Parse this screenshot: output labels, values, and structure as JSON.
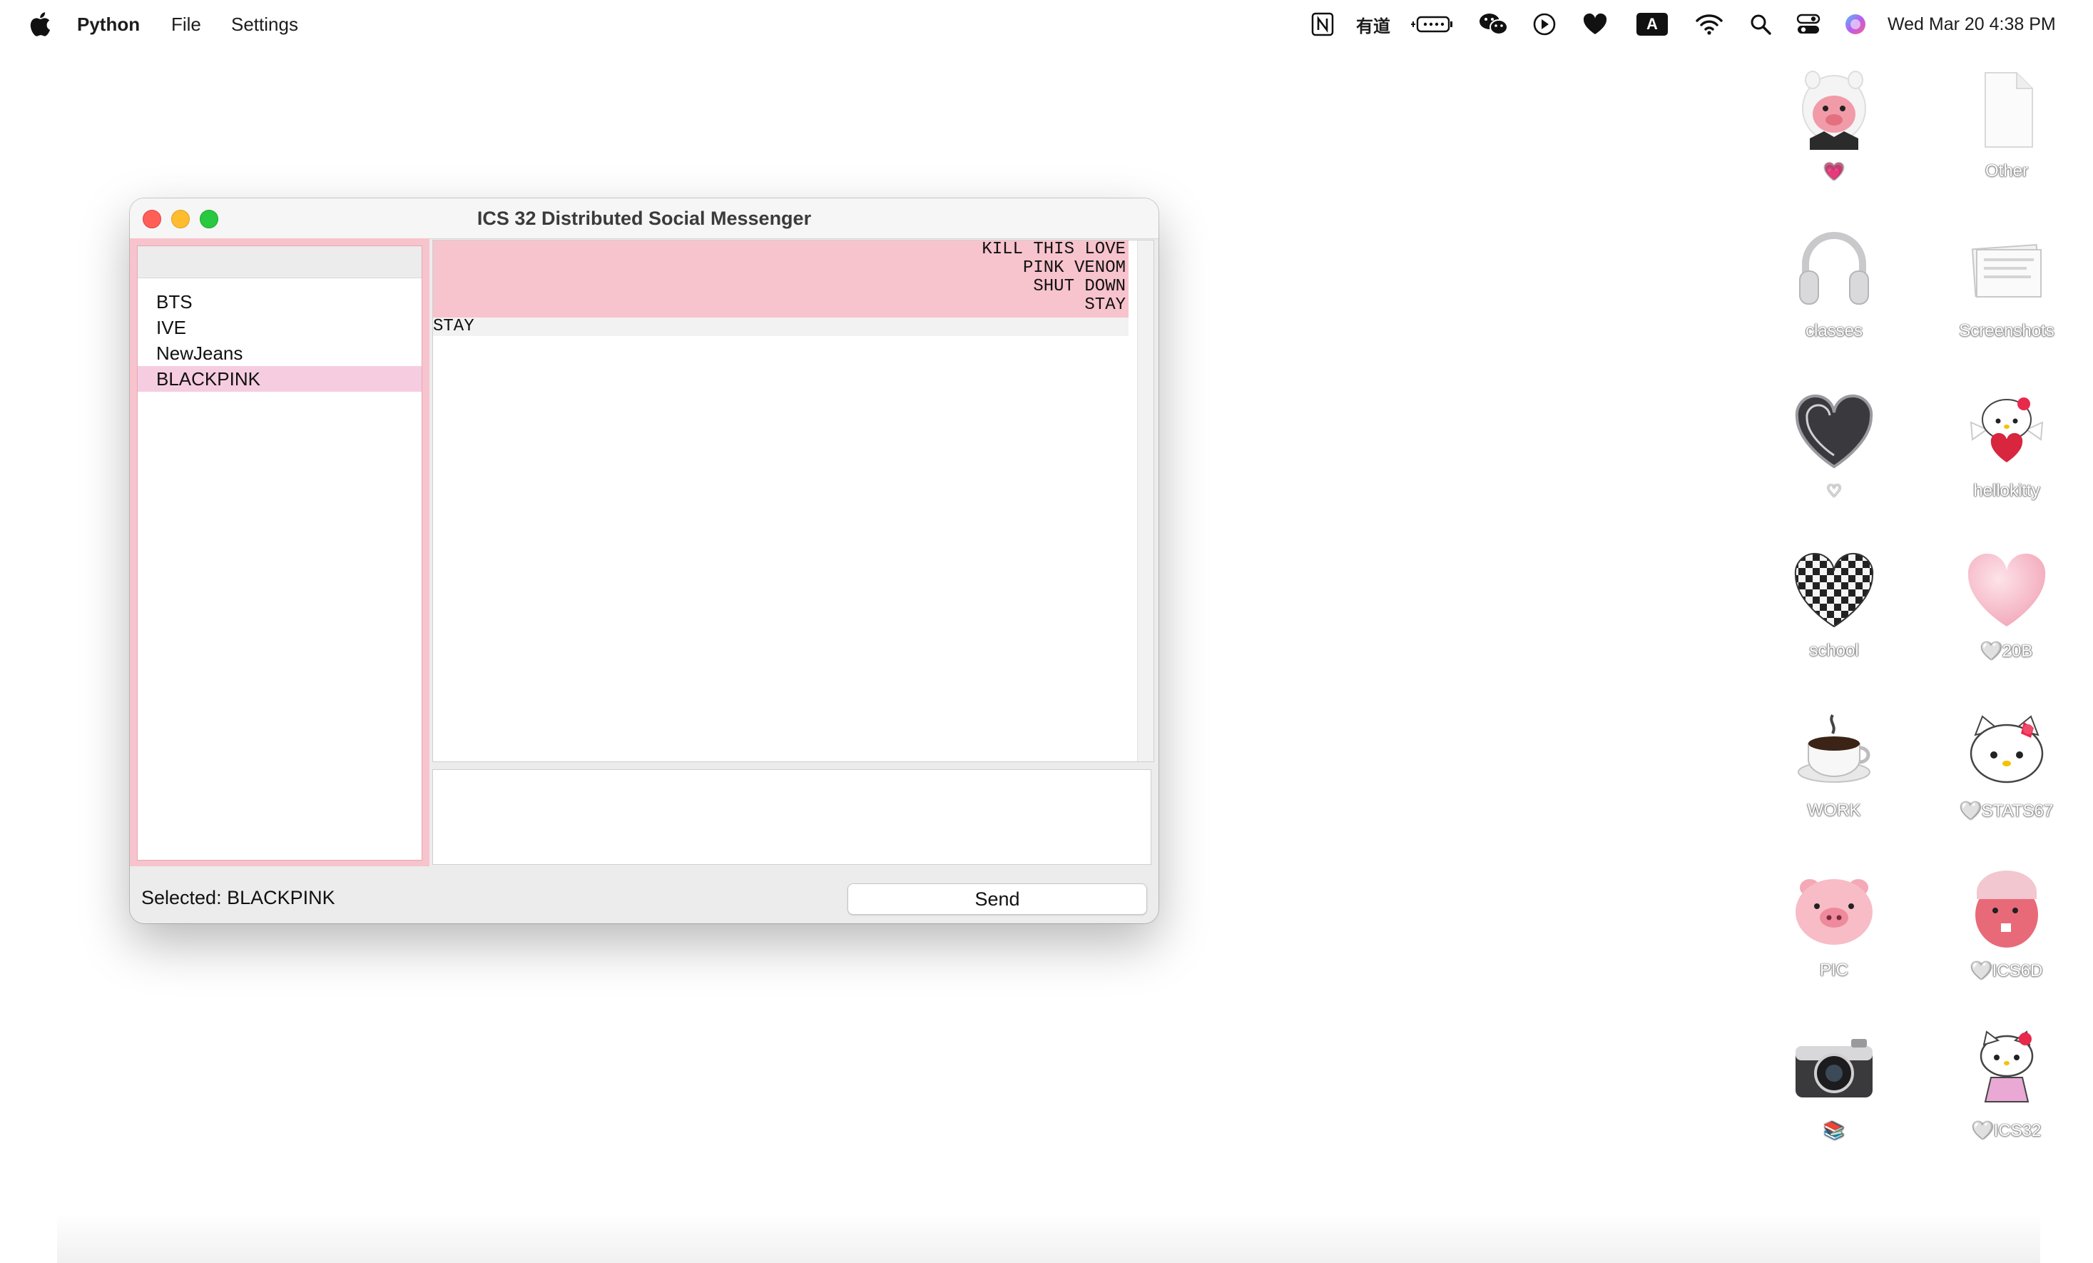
{
  "menubar": {
    "app_name": "Python",
    "menus": [
      "File",
      "Settings"
    ],
    "clock": "Wed Mar 20  4:38 PM",
    "youdao_label": "有道",
    "input_label": "A"
  },
  "window": {
    "title": "ICS 32 Distributed Social Messenger",
    "contacts": [
      "BTS",
      "IVE",
      "NewJeans",
      "BLACKPINK"
    ],
    "selected_contact": "BLACKPINK",
    "sent_messages": [
      "KILL THIS LOVE",
      "PINK VENOM",
      "SHUT DOWN",
      "STAY"
    ],
    "received_messages": [
      "STAY"
    ],
    "entry_value": "",
    "status_label": "Selected: BLACKPINK",
    "send_label": "Send",
    "accent_color": "#f7c3cd",
    "selected_color": "#f6cde0"
  },
  "desktop": {
    "icons": [
      {
        "label": "💗",
        "icon": "bear-pig-icon"
      },
      {
        "label": "Other",
        "icon": "file-icon"
      },
      {
        "label": "classes",
        "icon": "headphones-icon"
      },
      {
        "label": "Screenshots",
        "icon": "screenshots-folder-icon"
      },
      {
        "label": "♡",
        "icon": "metal-heart-icon"
      },
      {
        "label": "hellokitty",
        "icon": "hellokitty-angel-icon"
      },
      {
        "label": "school",
        "icon": "checker-heart-icon"
      },
      {
        "label": "🤍20B",
        "icon": "pink-heart-icon"
      },
      {
        "label": "WORK",
        "icon": "coffee-cup-icon"
      },
      {
        "label": "🤍STATS67",
        "icon": "hellokitty-face-icon"
      },
      {
        "label": "PIC",
        "icon": "pig-face-icon"
      },
      {
        "label": "🤍ICS6D",
        "icon": "beaver-icon"
      },
      {
        "label": "📚",
        "icon": "camera-icon"
      },
      {
        "label": "🤍ICS32",
        "icon": "hellokitty-icon"
      }
    ]
  }
}
